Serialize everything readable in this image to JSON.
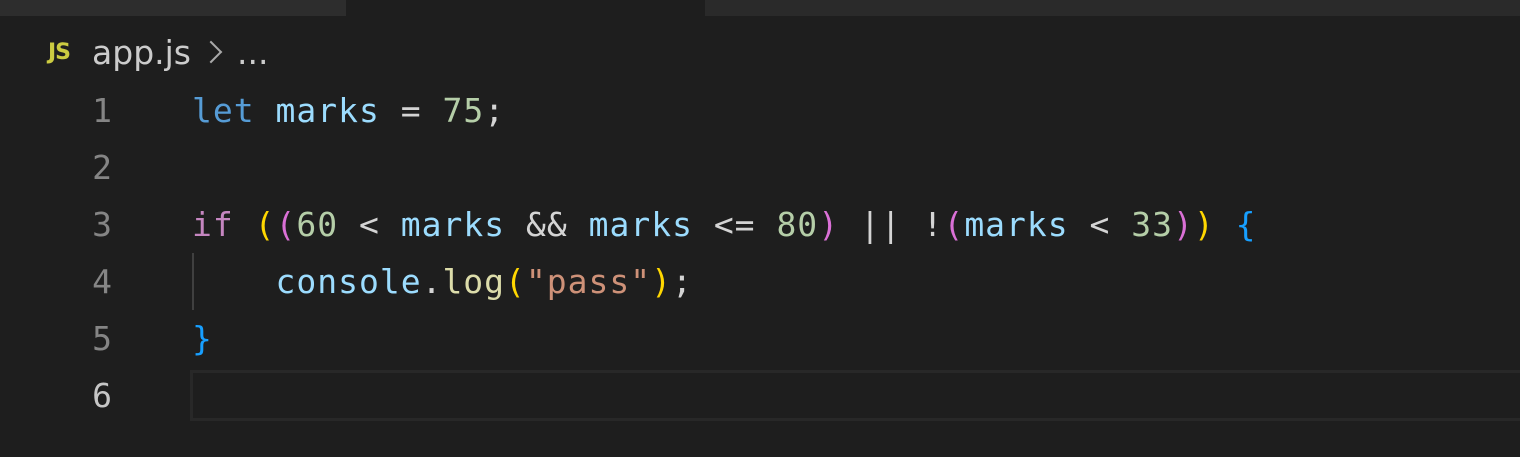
{
  "breadcrumb": {
    "icon": "JS",
    "file": "app.js",
    "ellipsis": "..."
  },
  "gutter": [
    "1",
    "2",
    "3",
    "4",
    "5",
    "6"
  ],
  "code": {
    "line1": {
      "kw": "let",
      "var": "marks",
      "eq": "=",
      "num": "75",
      "semi": ";"
    },
    "line3": {
      "kw": "if",
      "p1": "(",
      "p2": "(",
      "n60": "60",
      "lt": "<",
      "marks_a": "marks",
      "and": "&&",
      "marks_b": "marks",
      "le": "<=",
      "n80": "80",
      "p2c": ")",
      "or": "||",
      "not": "!",
      "p3": "(",
      "marks_c": "marks",
      "lt2": "<",
      "n33": "33",
      "p3c": ")",
      "p1c": ")",
      "brace": "{"
    },
    "line4": {
      "obj": "console",
      "dot": ".",
      "fn": "log",
      "po": "(",
      "str": "\"pass\"",
      "pc": ")",
      "semi": ";"
    },
    "line5": {
      "brace": "}"
    }
  },
  "colors": {
    "keyword_declaration": "#569cd6",
    "keyword_control": "#c586c0",
    "identifier": "#9cdcfe",
    "number": "#b5cea8",
    "string": "#ce9178",
    "function": "#dcdcaa",
    "bracket_level1": "#ffd700",
    "bracket_level2": "#da70d6",
    "bracket_level3": "#179fff",
    "background": "#1e1e1e"
  }
}
